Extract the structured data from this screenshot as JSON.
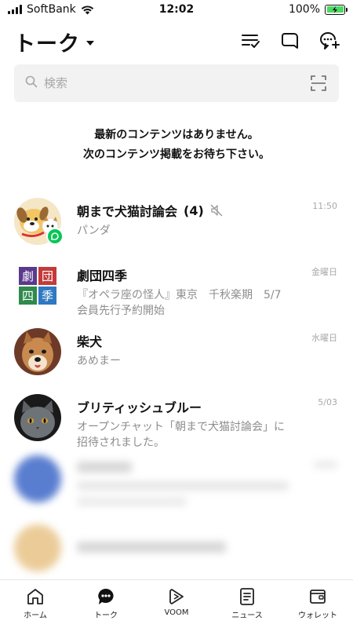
{
  "status_bar": {
    "carrier": "SoftBank",
    "time": "12:02",
    "battery": "100%",
    "battery_color": "#4cd964"
  },
  "header": {
    "title": "トーク",
    "caret_icon": "caret-down-icon",
    "icons": [
      "filter-list-icon",
      "new-chat-icon",
      "add-chat-icon"
    ]
  },
  "search": {
    "placeholder": "検索",
    "value": "",
    "left_icon": "search-icon",
    "right_icon": "qr-scan-icon"
  },
  "notice": {
    "line1": "最新のコンテンツはありません。",
    "line2": "次のコンテンツ掲載をお待ち下さい。"
  },
  "chats": [
    {
      "name": "朝まで犬猫討論会",
      "count": "(4)",
      "muted": true,
      "message": "パンダ",
      "time": "11:50",
      "avatar": "dog-cat-illustration"
    },
    {
      "name": "劇団四季",
      "message": "『オペラ座の怪人』東京　千秋楽期　5/7\n会員先行予約開始",
      "time": "金曜日",
      "avatar": "theater-logo",
      "logo_chars": [
        "劇",
        "団",
        "四",
        "季"
      ]
    },
    {
      "name": "柴犬",
      "message": "あめまー",
      "time": "水曜日",
      "avatar": "shiba-photo"
    },
    {
      "name": "ブリティッシュブルー",
      "message": "オープンチャット「朝まで犬猫討論会」に\n招待されました。",
      "time": "5/03",
      "avatar": "cat-photo"
    }
  ],
  "tabs": [
    {
      "label": "ホーム",
      "icon": "home-icon"
    },
    {
      "label": "トーク",
      "icon": "talk-icon",
      "active": true
    },
    {
      "label": "VOOM",
      "icon": "voom-icon"
    },
    {
      "label": "ニュース",
      "icon": "news-icon"
    },
    {
      "label": "ウォレット",
      "icon": "wallet-icon"
    }
  ],
  "colors": {
    "accent_green": "#06c755",
    "text_gray": "#8d8d8d"
  }
}
